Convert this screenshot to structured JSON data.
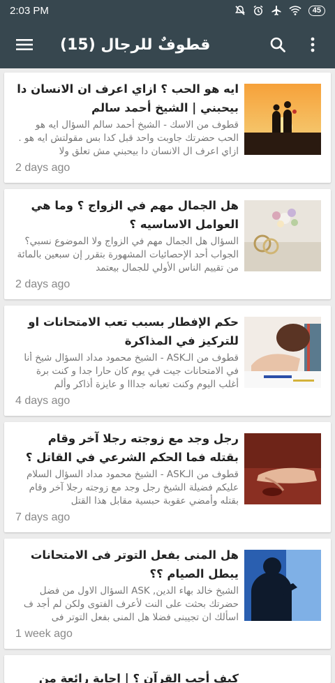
{
  "status_bar": {
    "time": "2:03 PM",
    "battery": "45"
  },
  "app_bar": {
    "title": "قطوفٌ للرجال (15)"
  },
  "articles": [
    {
      "title": "ايه هو الحب ؟ ازاي اعرف ان الانسان دا بيحبني | الشيخ أحمد سالم",
      "excerpt": "قطوف من الاسك - الشيخ أحمد سالم السؤال ايه هو الحب حضرتك جاوبت واحد قبل كدا بس مقولتش ايه هو . ازاي اعرف ال الانسان دا بيحبني مش تعلق ولا",
      "time": "2 days ago"
    },
    {
      "title": "هل الجمال مهم في الزواج ؟ وما هي العوامل الاساسيه ؟",
      "excerpt": "السؤال هل الجمال مهم في الزواج ولا الموضوع نسبي؟ الجواب  أحد الإحصائيات المشهورة بتقرر إن سبعين بالمائة من تقييم الناس الأولي للجمال بيعتمد",
      "time": "2 days ago"
    },
    {
      "title": "حكم الإفطار بسبب تعب الامتحانات او للتركيز في المذاكرة",
      "excerpt": "قطوف من الـASK - الشيخ محمود مداد السؤال شيخ أنا في الامتحانات جيت في يوم كان حارا جدا و كنت برة أغلب اليوم وكنت تعبانه جدااا و عايزة أذاكر وألم",
      "time": "4 days ago"
    },
    {
      "title": "رجل وجد مع زوجته رجلا آخر وقام بقتله فما الحكم الشرعي في القاتل ؟",
      "excerpt": "قطوف من الـASK - الشيخ محمود مداد السؤال السلام عليكم فضيلة الشيخ رجل وجد مع زوجته رجلا آخر وقام بقتله وأمضي عقوبة حبسية مقابل هذا القتل",
      "time": "7 days ago"
    },
    {
      "title": "هل المنى بفعل التوتر فى الامتحانات يبطل الصيام ؟؟",
      "excerpt": "الشيخ خالد بهاء الدين, ASK السؤال الاول من فضل حضرتك بحثت على النت لأعرف الفتوى ولكن لم أجد ف اسألك ان تجيبنى فضلا هل المنى بفعل التوتر فى",
      "time": "1 week ago"
    }
  ],
  "partial_article": {
    "title": "كيف أحب القرآن ؟ | إجابة رائعة من الشيخ عمرو الشرقاوي"
  }
}
